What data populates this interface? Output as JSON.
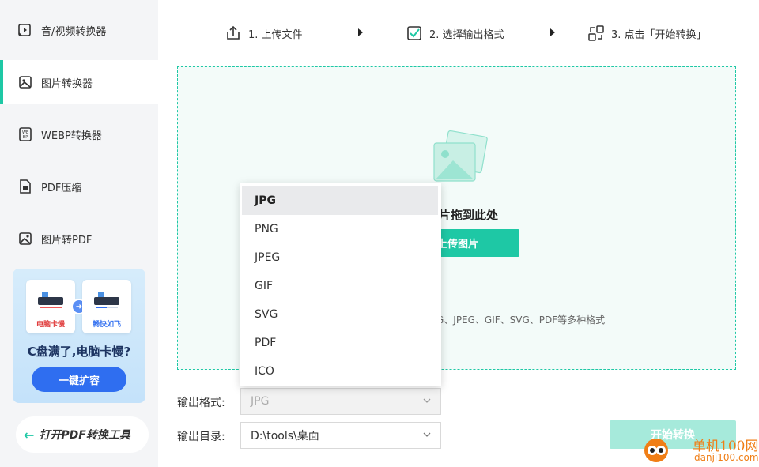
{
  "sidebar": {
    "items": [
      {
        "label": "音/视频转换器",
        "icon": "video-convert-icon"
      },
      {
        "label": "图片转换器",
        "icon": "image-convert-icon",
        "active": true
      },
      {
        "label": "WEBP转换器",
        "icon": "webp-icon"
      },
      {
        "label": "PDF压缩",
        "icon": "pdf-compress-icon"
      },
      {
        "label": "图片转PDF",
        "icon": "image-to-pdf-icon"
      }
    ],
    "promo": {
      "slow_label": "电脑卡慢",
      "fast_label": "畅快如飞",
      "title": "C盘满了,电脑卡慢?",
      "button": "一键扩容"
    },
    "open_pdf_tool": "打开PDF转换工具"
  },
  "steps": [
    {
      "label": "1. 上传文件",
      "icon": "upload-icon"
    },
    {
      "label": "2. 选择输出格式",
      "icon": "checkbox-icon"
    },
    {
      "label": "3. 点击「开始转换」",
      "icon": "convert-icon"
    }
  ],
  "dropzone": {
    "drag_text": "片拖到此处",
    "upload_button": "上传图片",
    "formats_hint": "NG、JPEG、GIF、SVG、PDF等多种格式"
  },
  "form": {
    "format_label": "输出格式:",
    "format_value": "JPG",
    "dir_label": "输出目录:",
    "dir_value": "D:\\tools\\桌面"
  },
  "dropdown": {
    "options": [
      "JPG",
      "PNG",
      "JPEG",
      "GIF",
      "SVG",
      "PDF",
      "ICO"
    ],
    "selected": "JPG"
  },
  "start_button": "开始转换",
  "watermark": {
    "name": "单机100网",
    "domain": "danji100.com"
  },
  "colors": {
    "accent": "#1ec8a5",
    "sidebar_bg": "#f4f5f7",
    "promo_button": "#2f6ef0",
    "watermark": "#f07e16"
  }
}
